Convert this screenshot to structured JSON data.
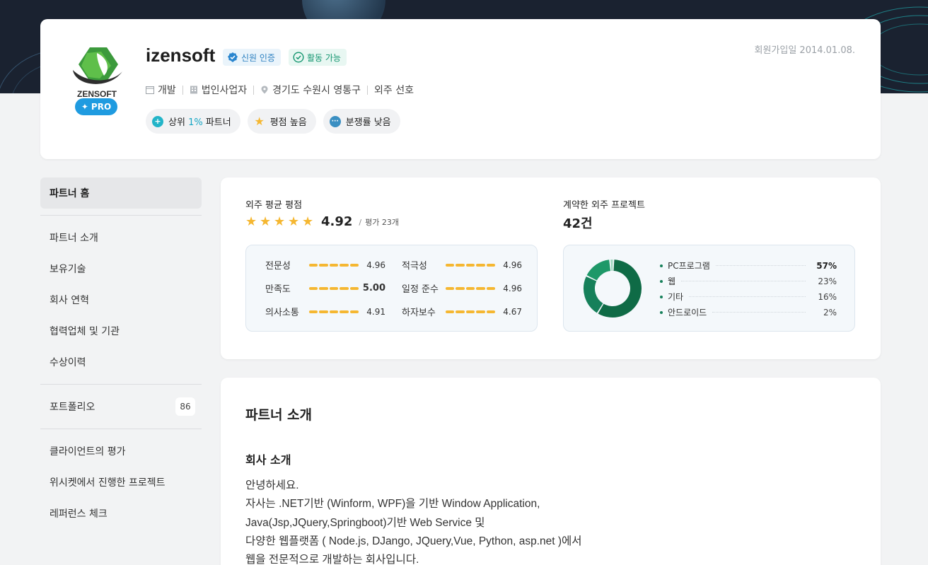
{
  "partner": {
    "name": "izensoft",
    "logo_text": "ZENSOFT",
    "pro_label": "PRO",
    "verified_label": "신원 인증",
    "active_label": "활동 가능",
    "join_date": "회원가입일 2014.01.08.",
    "meta": {
      "category": "개발",
      "business_type": "법인사업자",
      "location": "경기도 수원시 영통구",
      "preference": "외주 선호"
    },
    "chips": {
      "top_prefix": "상위",
      "top_value": "1%",
      "top_suffix": "파트너",
      "rating_high": "평점 높음",
      "dispute_low": "분쟁률 낮음"
    }
  },
  "sidebar": {
    "home": "파트너 홈",
    "group1": [
      "파트너 소개",
      "보유기술",
      "회사 연혁",
      "협력업체 및 기관",
      "수상이력"
    ],
    "portfolio_label": "포트폴리오",
    "portfolio_count": "86",
    "group3": [
      "클라이언트의 평가",
      "위시켓에서 진행한 프로젝트",
      "레퍼런스 체크"
    ]
  },
  "stats": {
    "rating_title": "외주 평균 평점",
    "rating_value": "4.92",
    "rating_sep": "/",
    "rating_count": "평가 23개",
    "rating_stars": 5,
    "projects_title": "계약한 외주 프로젝트",
    "projects_value": "42건",
    "scores": [
      {
        "label": "전문성",
        "value": "4.96",
        "bold": false
      },
      {
        "label": "적극성",
        "value": "4.96",
        "bold": false
      },
      {
        "label": "만족도",
        "value": "5.00",
        "bold": true
      },
      {
        "label": "일정 준수",
        "value": "4.96",
        "bold": false
      },
      {
        "label": "의사소통",
        "value": "4.91",
        "bold": false
      },
      {
        "label": "하자보수",
        "value": "4.67",
        "bold": false
      }
    ],
    "accent_color": "#f5b731"
  },
  "chart_data": {
    "type": "pie",
    "categories": [
      "PC프로그램",
      "웹",
      "기타",
      "안드로이드"
    ],
    "values": [
      57,
      23,
      16,
      2
    ],
    "labels": [
      "57%",
      "23%",
      "16%",
      "2%"
    ],
    "colors": [
      "#0f6b46",
      "#16805a",
      "#1e9868",
      "#9fd6bf"
    ],
    "donut": true
  },
  "intro": {
    "title": "파트너 소개",
    "subtitle": "회사 소개",
    "lines": [
      "안녕하세요.",
      "자사는 .NET기반 (Winform, WPF)을 기반 Window Application,",
      "Java(Jsp,JQuery,Springboot)기반 Web Service 및",
      "다양한 웹플랫폼 ( Node.js, DJango, JQuery,Vue, Python, asp.net )에서",
      "웹을 전문적으로 개발하는 회사입니다."
    ]
  }
}
